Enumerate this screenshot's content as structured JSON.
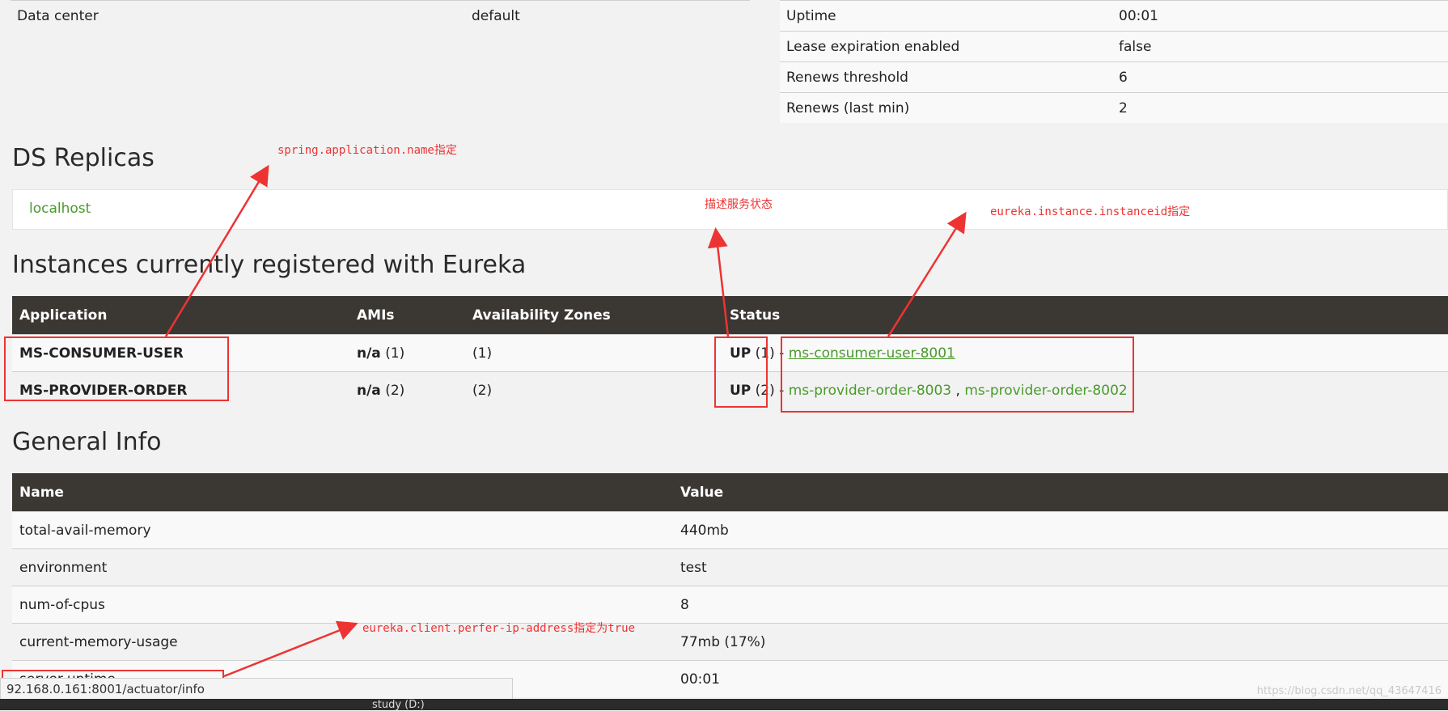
{
  "top_left": [
    {
      "key": "Data center",
      "value": "default"
    }
  ],
  "top_right": [
    {
      "key": "Uptime",
      "value": "00:01"
    },
    {
      "key": "Lease expiration enabled",
      "value": "false"
    },
    {
      "key": "Renews threshold",
      "value": "6"
    },
    {
      "key": "Renews (last min)",
      "value": "2"
    }
  ],
  "replicas": {
    "title": "DS Replicas",
    "link": "localhost"
  },
  "instances": {
    "title": "Instances currently registered with Eureka",
    "headers": [
      "Application",
      "AMIs",
      "Availability Zones",
      "Status"
    ],
    "rows": [
      {
        "app": "MS-CONSUMER-USER",
        "ami": "n/a",
        "ami_count": "(1)",
        "zones": "(1)",
        "status": "UP",
        "status_count": "(1) -",
        "links": [
          "ms-consumer-user-8001"
        ]
      },
      {
        "app": "MS-PROVIDER-ORDER",
        "ami": "n/a",
        "ami_count": "(2)",
        "zones": "(2)",
        "status": "UP",
        "status_count": "(2) -",
        "links": [
          "ms-provider-order-8003",
          "ms-provider-order-8002"
        ]
      }
    ]
  },
  "general": {
    "title": "General Info",
    "headers": [
      "Name",
      "Value"
    ],
    "rows": [
      {
        "name": "total-avail-memory",
        "value": "440mb"
      },
      {
        "name": "environment",
        "value": "test"
      },
      {
        "name": "num-of-cpus",
        "value": "8"
      },
      {
        "name": "current-memory-usage",
        "value": "77mb (17%)"
      },
      {
        "name": "server-uptime",
        "value": "00:01"
      }
    ]
  },
  "annotations": {
    "app_name": "spring.application.name指定",
    "status": "描述服务状态",
    "instance_id": "eureka.instance.instanceid指定",
    "ip_address": "eureka.client.perfer-ip-address指定为true"
  },
  "statusbar": {
    "url": "92.168.0.161:8001/actuator/info"
  },
  "taskbar": {
    "item": "study (D:)"
  },
  "watermark": "https://blog.csdn.net/qq_43647416",
  "colors": {
    "accent_green": "#4a9a2c",
    "header_bg": "#3b3833",
    "annotation_red": "#ee3333"
  }
}
